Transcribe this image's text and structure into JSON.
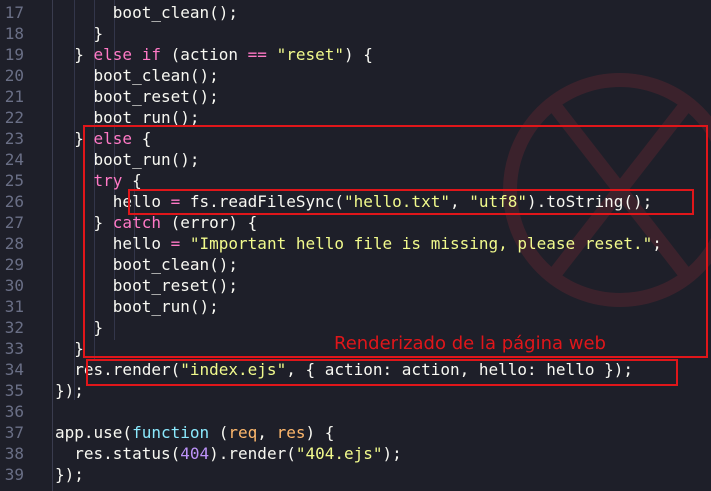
{
  "lines": [
    {
      "n": "17",
      "t": "          boot_clean();"
    },
    {
      "n": "18",
      "t": "        }"
    },
    {
      "n": "19",
      "t": "      } else if (action == \"reset\") {"
    },
    {
      "n": "20",
      "t": "        boot_clean();"
    },
    {
      "n": "21",
      "t": "        boot_reset();"
    },
    {
      "n": "22",
      "t": "        boot_run();"
    },
    {
      "n": "23",
      "t": "      } else {"
    },
    {
      "n": "24",
      "t": "        boot_run();"
    },
    {
      "n": "25",
      "t": "        try {"
    },
    {
      "n": "26",
      "t": "          hello = fs.readFileSync(\"hello.txt\", \"utf8\").toString();"
    },
    {
      "n": "27",
      "t": "        } catch (error) {"
    },
    {
      "n": "28",
      "t": "          hello = \"Important hello file is missing, please reset.\";"
    },
    {
      "n": "29",
      "t": "          boot_clean();"
    },
    {
      "n": "30",
      "t": "          boot_reset();"
    },
    {
      "n": "31",
      "t": "          boot_run();"
    },
    {
      "n": "32",
      "t": "        }"
    },
    {
      "n": "33",
      "t": "      }"
    },
    {
      "n": "34",
      "t": "      res.render(\"index.ejs\", { action: action, hello: hello });"
    },
    {
      "n": "35",
      "t": "    });"
    },
    {
      "n": "36",
      "t": ""
    },
    {
      "n": "37",
      "t": "    app.use(function (req, res) {"
    },
    {
      "n": "38",
      "t": "      res.status(404).render(\"404.ejs\");"
    },
    {
      "n": "39",
      "t": "    });"
    }
  ],
  "annotation": "Renderizado de la página web",
  "colors": {
    "background": "#1e1f29",
    "highlight": "#e0161a",
    "keyword": "#ff79c6",
    "string": "#f1fa8c",
    "number": "#bd93f9"
  }
}
